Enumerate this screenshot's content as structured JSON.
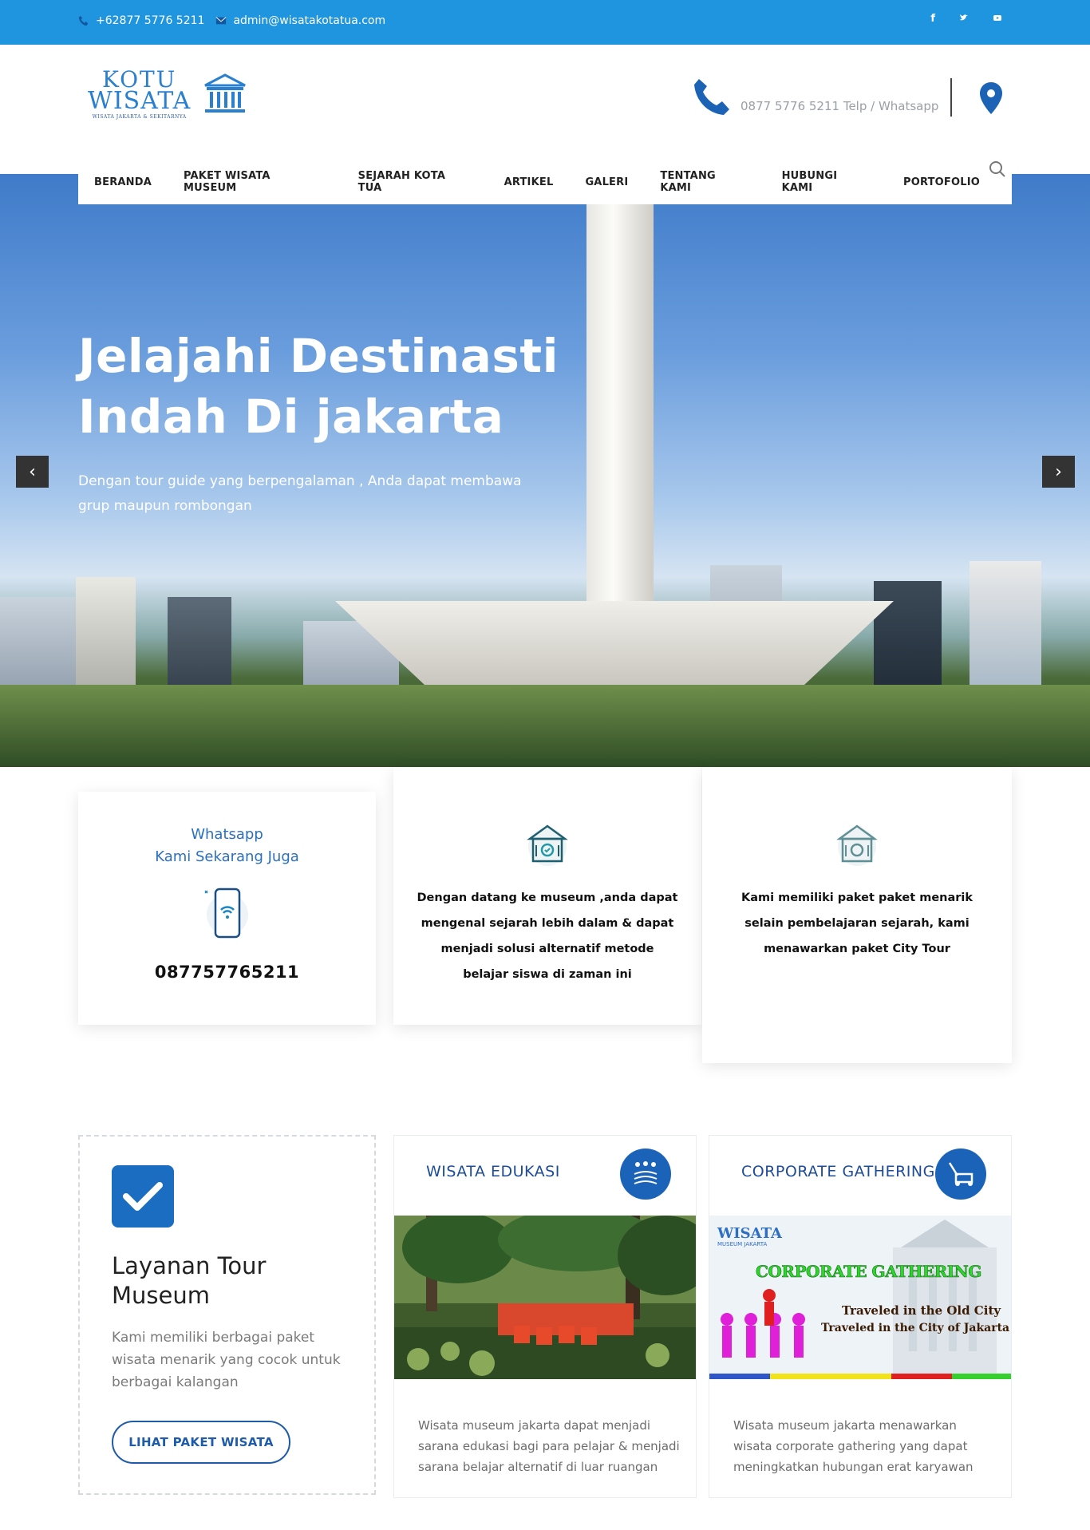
{
  "topbar": {
    "phone": "+62877 5776 5211",
    "email": "admin@wisatakotatua.com",
    "social": [
      "f",
      "t",
      "yt"
    ]
  },
  "header": {
    "logo_line1": "KOTU",
    "logo_line2": "WISATA",
    "logo_tagline": "WISATA JAKARTA & SEKITARNYA",
    "phone_text": "0877 5776 5211 Telp / Whatsapp"
  },
  "nav": {
    "items": [
      "BERANDA",
      "PAKET WISATA MUSEUM",
      "SEJARAH KOTA TUA",
      "ARTIKEL",
      "GALERI",
      "TENTANG KAMI",
      "HUBUNGI KAMI",
      "PORTOFOLIO"
    ]
  },
  "hero": {
    "title_line1": "Jelajahi Destinasti",
    "title_line2": "Indah Di jakarta",
    "subtitle_line1": "Dengan tour guide yang berpengalaman , Anda dapat membawa",
    "subtitle_line2": "grup maupun rombongan",
    "prev": "‹",
    "next": "›"
  },
  "cards": {
    "whatsapp_line1": "Whatsapp",
    "whatsapp_line2": "Kami Sekarang Juga",
    "whatsapp_number": "087757765211",
    "museum_lines": [
      "Dengan datang ke museum ,anda dapat",
      "mengenal sejarah lebih dalam & dapat",
      "menjadi solusi alternatif metode",
      "belajar siswa di zaman ini"
    ],
    "citytour_lines": [
      "Kami memiliki paket paket menarik",
      "selain pembelajaran sejarah, kami",
      "menawarkan paket City Tour"
    ]
  },
  "services": {
    "intro_title_line1": "Layanan Tour",
    "intro_title_line2": "Museum",
    "intro_text_lines": [
      "Kami memiliki berbagai paket",
      "wisata menarik yang cocok untuk",
      "berbagai kalangan"
    ],
    "intro_button": "LIHAT PAKET WISATA",
    "edukasi_title": "WISATA EDUKASI",
    "edukasi_lines": [
      "Wisata museum jakarta dapat menjadi",
      "sarana edukasi bagi para pelajar & menjadi",
      "sarana belajar alternatif di luar ruangan"
    ],
    "corporate_title": "CORPORATE GATHERING",
    "corporate_lines": [
      "Wisata museum jakarta menawarkan",
      "wisata corporate gathering yang dapat",
      "meningkatkan hubungan erat karyawan"
    ],
    "banner_logo": "WISATA",
    "banner_logo_sub": "MUSEUM JAKARTA",
    "banner_title": "CORPORATE GATHERING",
    "banner_line1": "Traveled in the Old City",
    "banner_line2": "Traveled in the City of Jakarta"
  }
}
